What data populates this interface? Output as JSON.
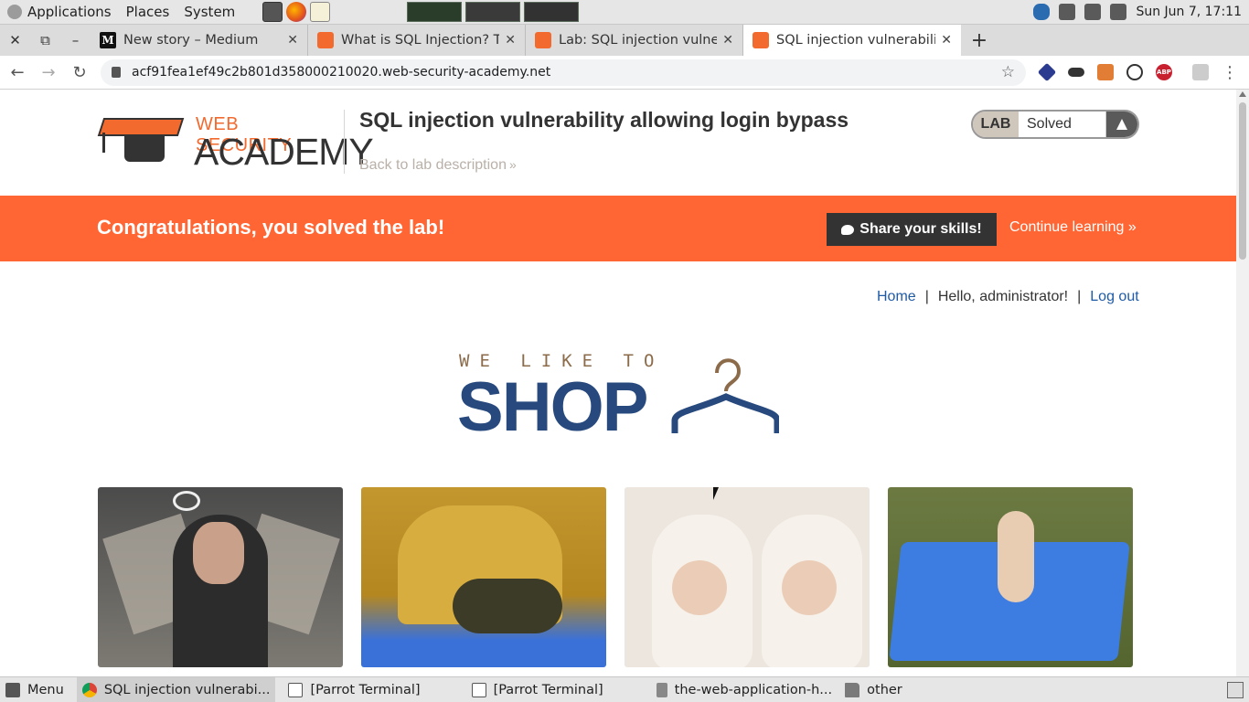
{
  "os_panel": {
    "menus": [
      "Applications",
      "Places",
      "System"
    ],
    "clock": "Sun Jun  7, 17:11"
  },
  "browser": {
    "tabs": [
      {
        "title": "New story – Medium",
        "favicon": "medium-icon",
        "active": false
      },
      {
        "title": "What is SQL Injection? Tu",
        "favicon": "wsa-icon",
        "active": false
      },
      {
        "title": "Lab: SQL injection vulnera",
        "favicon": "wsa-icon",
        "active": false
      },
      {
        "title": "SQL injection vulnerability",
        "favicon": "wsa-icon",
        "active": true
      }
    ],
    "url": "acf91fea1ef49c2b801d358000210020.web-security-academy.net",
    "favicon_medium_letter": "M"
  },
  "header": {
    "logo_top": "WEB SECURITY",
    "logo_bottom": "ACADEMY",
    "lab_title": "SQL injection vulnerability allowing login bypass",
    "back_link": "Back to lab description",
    "status_label": "LAB",
    "status_value": "Solved"
  },
  "banner": {
    "text": "Congratulations, you solved the lab!",
    "share_label": "Share your skills!",
    "continue_label": "Continue learning"
  },
  "topnav": {
    "home": "Home",
    "greeting": "Hello, administrator!",
    "logout": "Log out",
    "separator": "|"
  },
  "shop_logo": {
    "small": "WE LIKE TO",
    "big": "SHOP"
  },
  "taskbar": {
    "items": [
      {
        "label": "Menu",
        "icon": "menu-icon"
      },
      {
        "label": "SQL injection vulnerabi...",
        "icon": "chrome-icon"
      },
      {
        "label": "[Parrot Terminal]",
        "icon": "terminal-icon"
      },
      {
        "label": "[Parrot Terminal]",
        "icon": "terminal-icon"
      },
      {
        "label": "the-web-application-h...",
        "icon": "file-icon"
      },
      {
        "label": "other",
        "icon": "folder-icon"
      }
    ]
  },
  "colors": {
    "banner": "#ff6633",
    "brand_orange": "#f26a2e",
    "link_blue": "#1f5aa6",
    "shop_blue": "#27497d"
  }
}
